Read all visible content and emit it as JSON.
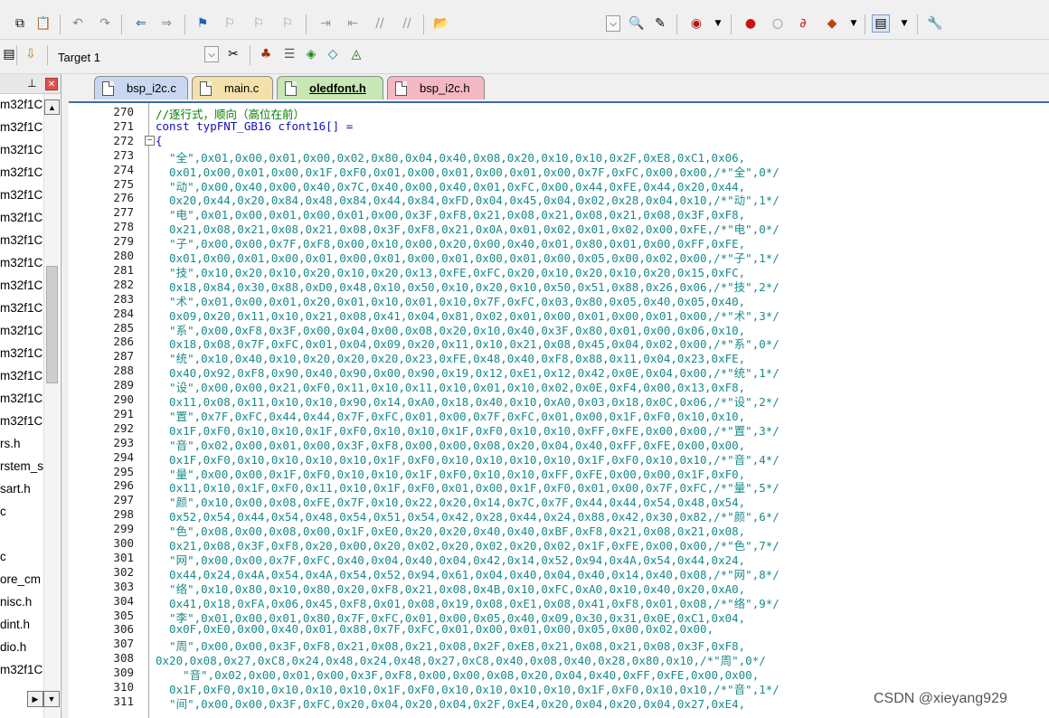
{
  "toolbar_top": {
    "icons": [
      "copy-icon",
      "paste-icon",
      "undo-icon",
      "redo-icon",
      "navigate-back-icon",
      "navigate-forward-icon",
      "bookmark-icon",
      "prev-bookmark-icon",
      "next-bookmark-icon",
      "clear-bookmarks-icon",
      "indent-icon",
      "unindent-icon",
      "comment-icon",
      "uncomment-icon",
      "find-in-files-icon",
      "dropdown-icon",
      "find-icon",
      "replace-icon",
      "debug-icon",
      "breakpoint-icon",
      "disable-breakpoint-icon",
      "kill-breakpoints-icon",
      "trace-icon",
      "window-layout-icon",
      "configure-icon"
    ]
  },
  "toolbar_target": {
    "target_name": "Target 1"
  },
  "project_panel": {
    "files": [
      "m32f1C",
      "m32f1C",
      "m32f1C",
      "m32f1C",
      "m32f1C",
      "m32f1C",
      "m32f1C",
      "m32f1C",
      "m32f1C",
      "m32f1C",
      "m32f1C",
      "m32f1C",
      "m32f1C",
      "m32f1C",
      "m32f1C",
      "rs.h",
      "rstem_s",
      "sart.h",
      "c",
      "",
      "c",
      "ore_cm",
      "nisc.h",
      "dint.h",
      "dio.h",
      "m32f1C"
    ]
  },
  "tabs": [
    {
      "label": "bsp_i2c.c"
    },
    {
      "label": "main.c"
    },
    {
      "label": "oledfont.h"
    },
    {
      "label": "bsp_i2c.h"
    }
  ],
  "editor": {
    "lines": [
      {
        "n": "270",
        "text": "//逐行式，顺向（高位在前）",
        "style": "comment"
      },
      {
        "n": "271",
        "text": "const typFNT_GB16 cfont16[] =",
        "style": "kw"
      },
      {
        "n": "272",
        "text": "{",
        "style": "kw"
      },
      {
        "n": "273",
        "text": "  \"全\",0x01,0x00,0x01,0x00,0x02,0x80,0x04,0x40,0x08,0x20,0x10,0x10,0x2F,0xE8,0xC1,0x06,",
        "style": "str"
      },
      {
        "n": "274",
        "text": "  0x01,0x00,0x01,0x00,0x1F,0xF0,0x01,0x00,0x01,0x00,0x01,0x00,0x7F,0xFC,0x00,0x00,/*\"全\",0*/",
        "style": "str"
      },
      {
        "n": "275",
        "text": "  \"动\",0x00,0x40,0x00,0x40,0x7C,0x40,0x00,0x40,0x01,0xFC,0x00,0x44,0xFE,0x44,0x20,0x44,",
        "style": "str"
      },
      {
        "n": "276",
        "text": "  0x20,0x44,0x20,0x84,0x48,0x84,0x44,0x84,0xFD,0x04,0x45,0x04,0x02,0x28,0x04,0x10,/*\"动\",1*/",
        "style": "str"
      },
      {
        "n": "277",
        "text": "  \"电\",0x01,0x00,0x01,0x00,0x01,0x00,0x3F,0xF8,0x21,0x08,0x21,0x08,0x21,0x08,0x3F,0xF8,",
        "style": "str"
      },
      {
        "n": "278",
        "text": "  0x21,0x08,0x21,0x08,0x21,0x08,0x3F,0xF8,0x21,0x0A,0x01,0x02,0x01,0x02,0x00,0xFE,/*\"电\",0*/",
        "style": "str"
      },
      {
        "n": "279",
        "text": "  \"子\",0x00,0x00,0x7F,0xF8,0x00,0x10,0x00,0x20,0x00,0x40,0x01,0x80,0x01,0x00,0xFF,0xFE,",
        "style": "str"
      },
      {
        "n": "280",
        "text": "  0x01,0x00,0x01,0x00,0x01,0x00,0x01,0x00,0x01,0x00,0x01,0x00,0x05,0x00,0x02,0x00,/*\"子\",1*/",
        "style": "str"
      },
      {
        "n": "281",
        "text": "  \"技\",0x10,0x20,0x10,0x20,0x10,0x20,0x13,0xFE,0xFC,0x20,0x10,0x20,0x10,0x20,0x15,0xFC,",
        "style": "str"
      },
      {
        "n": "282",
        "text": "  0x18,0x84,0x30,0x88,0xD0,0x48,0x10,0x50,0x10,0x20,0x10,0x50,0x51,0x88,0x26,0x06,/*\"技\",2*/",
        "style": "str"
      },
      {
        "n": "283",
        "text": "  \"术\",0x01,0x00,0x01,0x20,0x01,0x10,0x01,0x10,0x7F,0xFC,0x03,0x80,0x05,0x40,0x05,0x40,",
        "style": "str"
      },
      {
        "n": "284",
        "text": "  0x09,0x20,0x11,0x10,0x21,0x08,0x41,0x04,0x81,0x02,0x01,0x00,0x01,0x00,0x01,0x00,/*\"术\",3*/",
        "style": "str"
      },
      {
        "n": "285",
        "text": "  \"系\",0x00,0xF8,0x3F,0x00,0x04,0x00,0x08,0x20,0x10,0x40,0x3F,0x80,0x01,0x00,0x06,0x10,",
        "style": "str"
      },
      {
        "n": "286",
        "text": "  0x18,0x08,0x7F,0xFC,0x01,0x04,0x09,0x20,0x11,0x10,0x21,0x08,0x45,0x04,0x02,0x00,/*\"系\",0*/",
        "style": "str"
      },
      {
        "n": "287",
        "text": "  \"统\",0x10,0x40,0x10,0x20,0x20,0x20,0x23,0xFE,0x48,0x40,0xF8,0x88,0x11,0x04,0x23,0xFE,",
        "style": "str"
      },
      {
        "n": "288",
        "text": "  0x40,0x92,0xF8,0x90,0x40,0x90,0x00,0x90,0x19,0x12,0xE1,0x12,0x42,0x0E,0x04,0x00,/*\"统\",1*/",
        "style": "str"
      },
      {
        "n": "289",
        "text": "  \"设\",0x00,0x00,0x21,0xF0,0x11,0x10,0x11,0x10,0x01,0x10,0x02,0x0E,0xF4,0x00,0x13,0xF8,",
        "style": "str"
      },
      {
        "n": "290",
        "text": "  0x11,0x08,0x11,0x10,0x10,0x90,0x14,0xA0,0x18,0x40,0x10,0xA0,0x03,0x18,0x0C,0x06,/*\"设\",2*/",
        "style": "str"
      },
      {
        "n": "291",
        "text": "  \"置\",0x7F,0xFC,0x44,0x44,0x7F,0xFC,0x01,0x00,0x7F,0xFC,0x01,0x00,0x1F,0xF0,0x10,0x10,",
        "style": "str"
      },
      {
        "n": "292",
        "text": "  0x1F,0xF0,0x10,0x10,0x1F,0xF0,0x10,0x10,0x1F,0xF0,0x10,0x10,0xFF,0xFE,0x00,0x00,/*\"置\",3*/",
        "style": "str"
      },
      {
        "n": "293",
        "text": "  \"音\",0x02,0x00,0x01,0x00,0x3F,0xF8,0x00,0x00,0x08,0x20,0x04,0x40,0xFF,0xFE,0x00,0x00,",
        "style": "str"
      },
      {
        "n": "294",
        "text": "  0x1F,0xF0,0x10,0x10,0x10,0x10,0x1F,0xF0,0x10,0x10,0x10,0x10,0x1F,0xF0,0x10,0x10,/*\"音\",4*/",
        "style": "str"
      },
      {
        "n": "295",
        "text": "  \"量\",0x00,0x00,0x1F,0xF0,0x10,0x10,0x1F,0xF0,0x10,0x10,0xFF,0xFE,0x00,0x00,0x1F,0xF0,",
        "style": "str"
      },
      {
        "n": "296",
        "text": "  0x11,0x10,0x1F,0xF0,0x11,0x10,0x1F,0xF0,0x01,0x00,0x1F,0xF0,0x01,0x00,0x7F,0xFC,/*\"量\",5*/",
        "style": "str"
      },
      {
        "n": "297",
        "text": "  \"颜\",0x10,0x00,0x08,0xFE,0x7F,0x10,0x22,0x20,0x14,0x7C,0x7F,0x44,0x44,0x54,0x48,0x54,",
        "style": "str"
      },
      {
        "n": "298",
        "text": "  0x52,0x54,0x44,0x54,0x48,0x54,0x51,0x54,0x42,0x28,0x44,0x24,0x88,0x42,0x30,0x82,/*\"颜\",6*/",
        "style": "str"
      },
      {
        "n": "299",
        "text": "  \"色\",0x08,0x00,0x08,0x00,0x1F,0xE0,0x20,0x20,0x40,0x40,0xBF,0xF8,0x21,0x08,0x21,0x08,",
        "style": "str"
      },
      {
        "n": "300",
        "text": "  0x21,0x08,0x3F,0xF8,0x20,0x00,0x20,0x02,0x20,0x02,0x20,0x02,0x1F,0xFE,0x00,0x00,/*\"色\",7*/",
        "style": "str"
      },
      {
        "n": "301",
        "text": "  \"网\",0x00,0x00,0x7F,0xFC,0x40,0x04,0x40,0x04,0x42,0x14,0x52,0x94,0x4A,0x54,0x44,0x24,",
        "style": "str"
      },
      {
        "n": "302",
        "text": "  0x44,0x24,0x4A,0x54,0x4A,0x54,0x52,0x94,0x61,0x04,0x40,0x04,0x40,0x14,0x40,0x08,/*\"网\",8*/",
        "style": "str"
      },
      {
        "n": "303",
        "text": "  \"络\",0x10,0x80,0x10,0x80,0x20,0xF8,0x21,0x08,0x4B,0x10,0xFC,0xA0,0x10,0x40,0x20,0xA0,",
        "style": "str"
      },
      {
        "n": "304",
        "text": "  0x41,0x18,0xFA,0x06,0x45,0xF8,0x01,0x08,0x19,0x08,0xE1,0x08,0x41,0xF8,0x01,0x08,/*\"络\",9*/",
        "style": "str"
      },
      {
        "n": "305",
        "text": "  \"李\",0x01,0x00,0x01,0x80,0x7F,0xFC,0x01,0x00,0x05,0x40,0x09,0x30,0x31,0x0E,0xC1,0x04,",
        "style": "str"
      },
      {
        "n": "306",
        "text": "  0x0F,0xE0,0x00,0x40,0x01,0x88,0x7F,0xFC,0x01,0x00,0x01,0x00,0x05,0x00,0x02,0x00,",
        "style": "str"
      },
      {
        "n": "307",
        "text": "  \"周\",0x00,0x00,0x3F,0xF8,0x21,0x08,0x21,0x08,0x2F,0xE8,0x21,0x08,0x21,0x08,0x3F,0xF8,",
        "style": "str"
      },
      {
        "n": "308",
        "text": "0x20,0x08,0x27,0xC8,0x24,0x48,0x24,0x48,0x27,0xC8,0x40,0x08,0x40,0x28,0x80,0x10,/*\"周\",0*/",
        "style": "str"
      },
      {
        "n": "309",
        "text": "    \"音\",0x02,0x00,0x01,0x00,0x3F,0xF8,0x00,0x00,0x08,0x20,0x04,0x40,0xFF,0xFE,0x00,0x00,",
        "style": "str"
      },
      {
        "n": "310",
        "text": "  0x1F,0xF0,0x10,0x10,0x10,0x10,0x1F,0xF0,0x10,0x10,0x10,0x10,0x1F,0xF0,0x10,0x10,/*\"音\",1*/",
        "style": "str"
      },
      {
        "n": "311",
        "text": "  \"间\",0x00,0x00,0x3F,0xFC,0x20,0x04,0x20,0x04,0x2F,0xE4,0x20,0x04,0x20,0x04,0x27,0xE4,",
        "style": "str"
      }
    ]
  },
  "watermark": "CSDN @xieyang929"
}
